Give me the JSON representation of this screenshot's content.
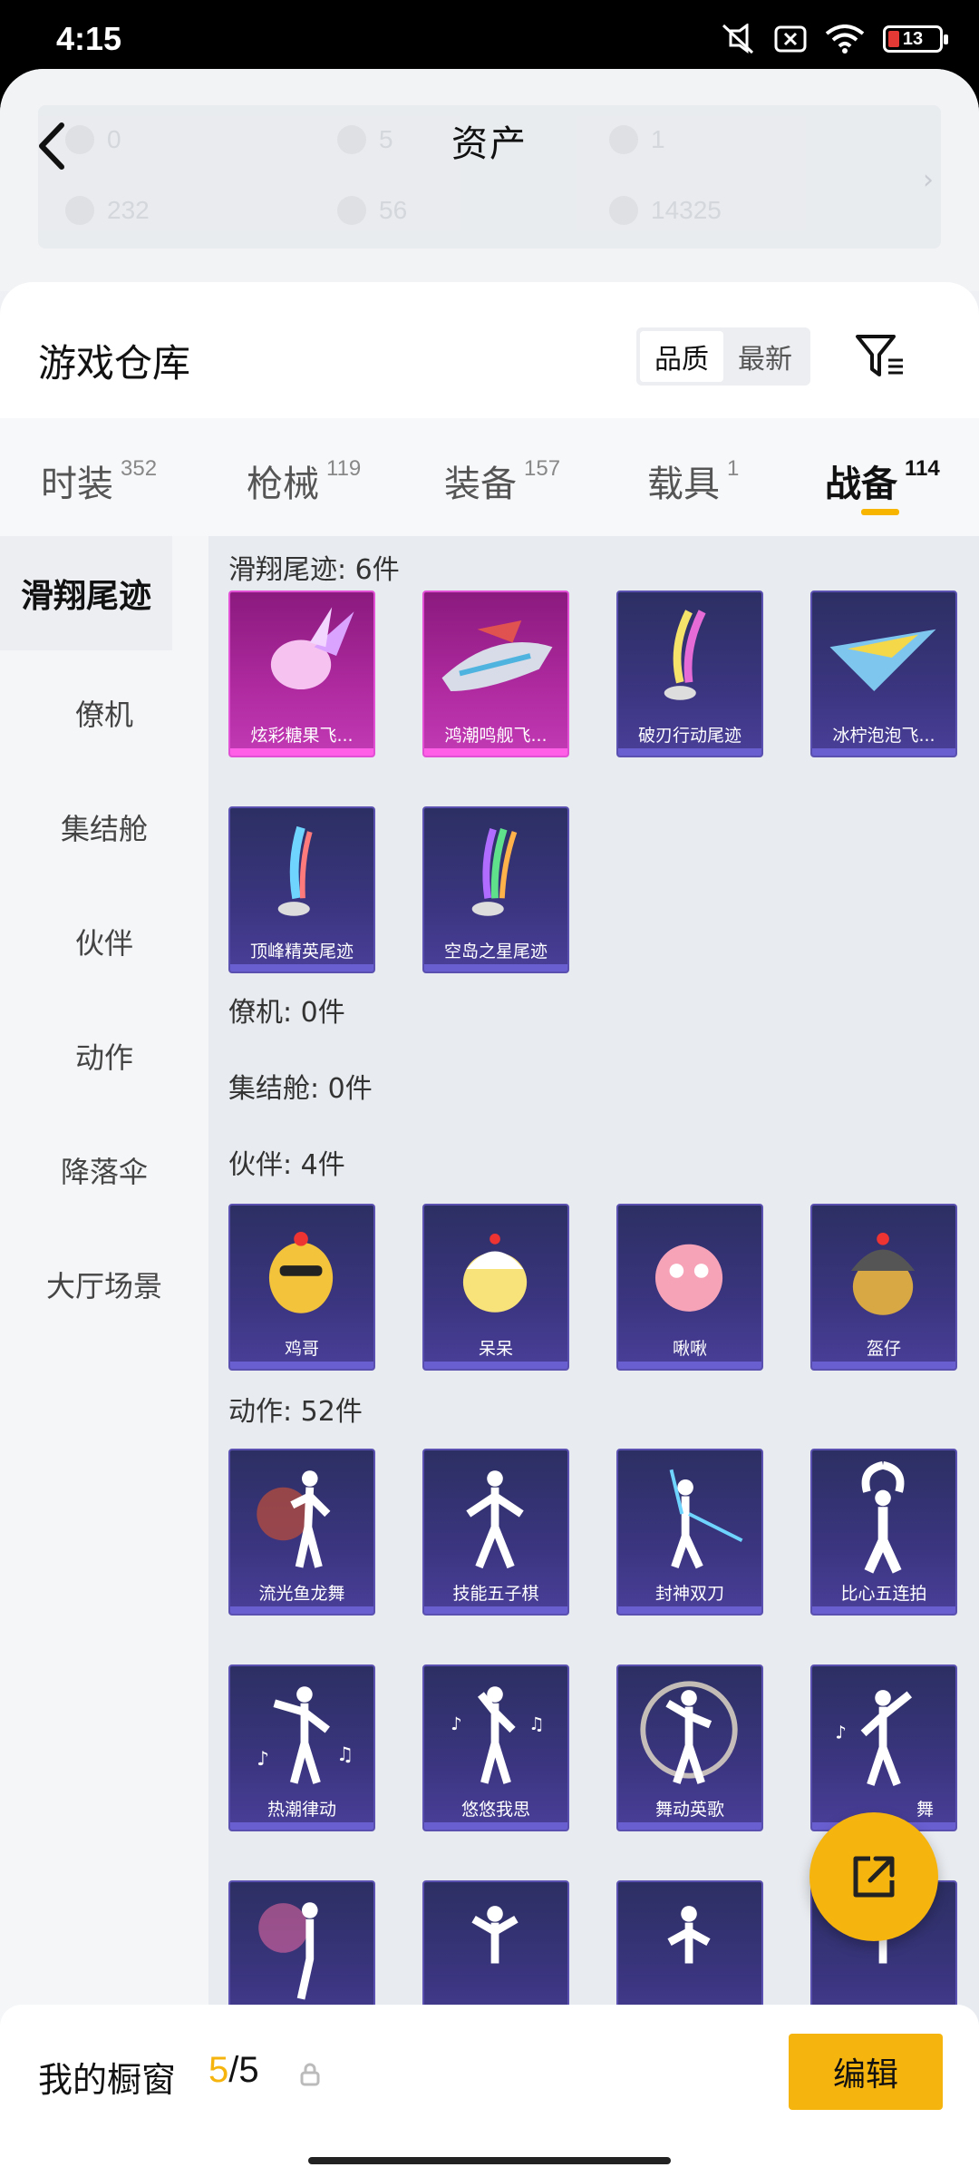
{
  "status_bar": {
    "time": "4:15",
    "battery": "13"
  },
  "assets": {
    "title": "资产",
    "row1": [
      "0",
      "5",
      "1"
    ],
    "row2": [
      "232",
      "56",
      "14325"
    ]
  },
  "warehouse": {
    "title": "游戏仓库",
    "sort": {
      "quality": "品质",
      "newest": "最新"
    }
  },
  "tabs": [
    {
      "label": "时装",
      "count": "352"
    },
    {
      "label": "枪械",
      "count": "119"
    },
    {
      "label": "装备",
      "count": "157"
    },
    {
      "label": "载具",
      "count": "1"
    },
    {
      "label": "战备",
      "count": "114"
    }
  ],
  "left_nav": [
    "滑翔尾迹",
    "僚机",
    "集结舱",
    "伙伴",
    "动作",
    "降落伞",
    "大厅场景"
  ],
  "sections": {
    "glide": {
      "title": "滑翔尾迹: 6件",
      "items": [
        "炫彩糖果飞...",
        "鸿潮鸣舰飞...",
        "破刃行动尾迹",
        "冰柠泡泡飞...",
        "顶峰精英尾迹",
        "空岛之星尾迹"
      ]
    },
    "wingman": {
      "title": "僚机: 0件"
    },
    "pod": {
      "title": "集结舱: 0件"
    },
    "partner": {
      "title": "伙伴: 4件",
      "items": [
        "鸡哥",
        "呆呆",
        "啾啾",
        "盔仔"
      ]
    },
    "emote": {
      "title": "动作: 52件",
      "items": [
        "流光鱼龙舞",
        "技能五子棋",
        "封神双刀",
        "比心五连拍",
        "热潮律动",
        "悠悠我思",
        "舞动英歌",
        "舞"
      ]
    }
  },
  "bottom": {
    "label": "我的橱窗",
    "current": "5",
    "total": "/5",
    "edit": "编辑"
  },
  "colors": {
    "accent": "#f6b40e",
    "card_purple": "#3b3580",
    "card_pink": "#b02aa0"
  },
  "icons": [
    "back-arrow-icon",
    "filter-icon",
    "share-icon",
    "lock-icon",
    "chevron-right-icon"
  ]
}
